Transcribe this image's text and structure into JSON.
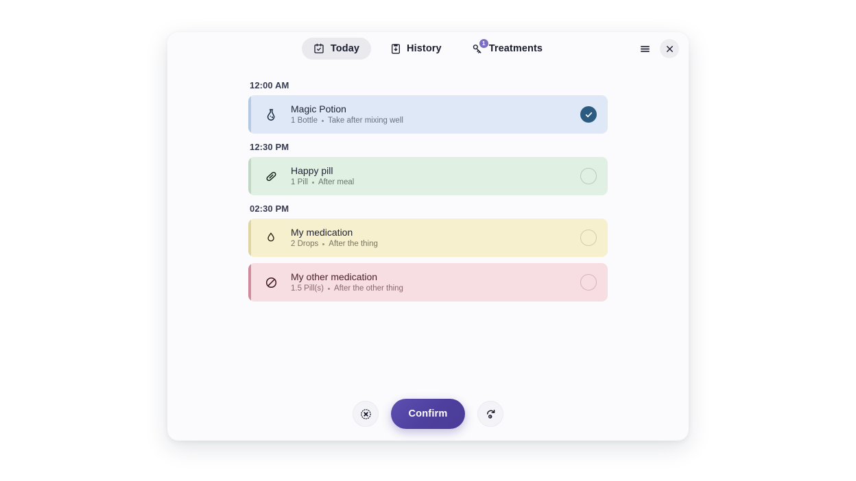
{
  "header": {
    "tabs": [
      {
        "label": "Today",
        "icon": "calendar-check-icon",
        "active": true,
        "badge": null
      },
      {
        "label": "History",
        "icon": "clipboard-icon",
        "active": false,
        "badge": null
      },
      {
        "label": "Treatments",
        "icon": "pill-syringe-icon",
        "active": false,
        "badge": "1"
      }
    ],
    "menu_label": "menu",
    "close_label": "close"
  },
  "schedule": {
    "groups": [
      {
        "time": "12:00 AM",
        "items": [
          {
            "name": "Magic Potion",
            "dose": "1 Bottle",
            "note": "Take after mixing well",
            "icon": "potion-flask-icon",
            "color": "blue",
            "state": "done"
          }
        ]
      },
      {
        "time": "12:30 PM",
        "items": [
          {
            "name": "Happy pill",
            "dose": "1 Pill",
            "note": "After meal",
            "icon": "capsule-icon",
            "color": "green",
            "state": "todo"
          }
        ]
      },
      {
        "time": "02:30 PM",
        "items": [
          {
            "name": "My medication",
            "dose": "2 Drops",
            "note": "After the thing",
            "icon": "droplet-icon",
            "color": "yellow",
            "state": "todo"
          },
          {
            "name": "My other medication",
            "dose": "1.5 Pill(s)",
            "note": "After the other thing",
            "icon": "circle-slash-icon",
            "color": "pink",
            "state": "todo"
          }
        ]
      }
    ]
  },
  "footer": {
    "skip_label": "skip-all",
    "confirm_label": "Confirm",
    "snooze_label": "snooze"
  },
  "colors": {
    "accent": "#4e3f9e",
    "badge": "#7b6cc4",
    "checked": "#2b5b80",
    "card_blue": "#dfe8f6",
    "card_green": "#e0f0e2",
    "card_yellow": "#f6f0cf",
    "card_pink": "#f7dee2",
    "dialog_bg": "#fbfbfd"
  }
}
